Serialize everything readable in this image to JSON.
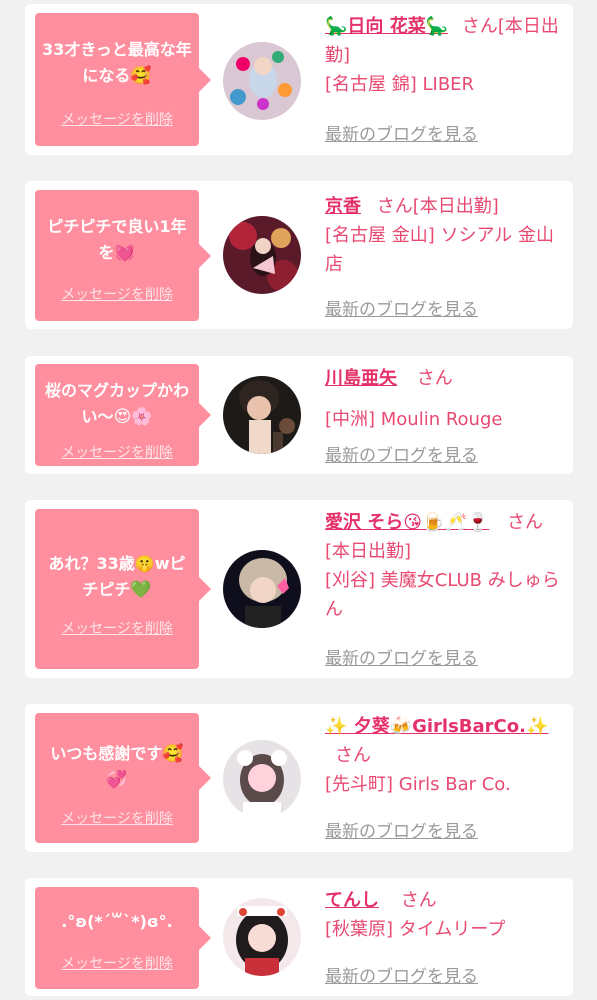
{
  "cards": [
    {
      "message": "33才きっと最高な年になる",
      "message_emoji": "🥰",
      "delete_label": "メッセージを削除",
      "name_prefix": "🦕",
      "name": "日向 花菜",
      "name_suffix": "🦕",
      "honorific": "さん",
      "status": "[本日出勤]",
      "shop": "[名古屋 錦] LIBER",
      "blog_link": "最新のブログを見る"
    },
    {
      "message": "ピチピチで良い1年を",
      "message_emoji": "💓",
      "delete_label": "メッセージを削除",
      "name_prefix": "",
      "name": "京香",
      "name_suffix": "",
      "honorific": "さん",
      "status": "[本日出勤]",
      "shop": "[名古屋 金山] ソシアル 金山店",
      "blog_link": "最新のブログを見る"
    },
    {
      "message": "桜のマグカップかわい〜",
      "message_emoji": "😍🌸",
      "delete_label": "メッセージを削除",
      "name_prefix": "",
      "name": "川島亜矢",
      "name_suffix": "",
      "honorific": "さん",
      "status": "",
      "shop": "[中洲] Moulin Rouge",
      "blog_link": "最新のブログを見る"
    },
    {
      "message": "あれ？33歳🤫wピチピチ",
      "message_emoji": "💚",
      "delete_label": "メッセージを削除",
      "name_prefix": "",
      "name": "愛沢 そら",
      "name_suffix": "😘🍺🥂🍷",
      "honorific": "さん",
      "status": "[本日出勤]",
      "shop": "[刈谷] 美魔女CLUB みしゅらん",
      "blog_link": "最新のブログを見る"
    },
    {
      "message": "いつも感謝です",
      "message_emoji": "🥰💞",
      "delete_label": "メッセージを削除",
      "name_prefix": "✨",
      "name": " 夕葵🍻GirlsBarCo.",
      "name_suffix": "✨",
      "honorific": "さん",
      "status": "",
      "shop": "[先斗町] Girls Bar Co.",
      "blog_link": "最新のブログを見る"
    },
    {
      "message": ".°ʚ(*´꒳`*)ɞ°.",
      "message_emoji": "",
      "delete_label": "メッセージを削除",
      "name_prefix": "",
      "name": "てんし",
      "name_suffix": "",
      "honorific": "さん",
      "status": "",
      "shop": "[秋葉原] タイムリープ",
      "blog_link": "最新のブログを見る"
    }
  ],
  "colors": {
    "bubble": "#ff8f9e",
    "name": "#e5316a",
    "text": "#e84a72",
    "link": "#9a9a9a",
    "background": "#f1f1f1"
  }
}
